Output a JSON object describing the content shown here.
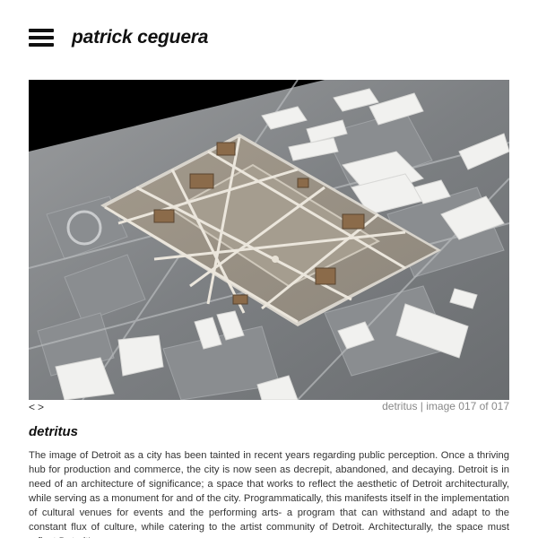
{
  "header": {
    "menu_icon": "hamburger-menu-icon",
    "site_title": "patrick ceguera"
  },
  "gallery": {
    "image_alt": "architectural site model of Detroit",
    "prev_label": "<",
    "next_label": ">",
    "caption": "detritus | image 017 of 017"
  },
  "project": {
    "title": "detritus",
    "description": "The image of Detroit as a city has been tainted in recent years regarding public perception. Once a thriving hub for production and commerce, the city is now seen as decrepit, abandoned, and decaying. Detroit is in need of an architecture of significance; a space that works to reflect the aesthetic of Detroit architecturally, while serving as a monument for and of the city. Programmatically, this manifests itself in the implementation of cultural venues for events and the performing arts- a program that can withstand and adapt to the constant flux of culture, while catering to the artist community of Detroit. Architecturally, the space must reflect Detroit's"
  }
}
